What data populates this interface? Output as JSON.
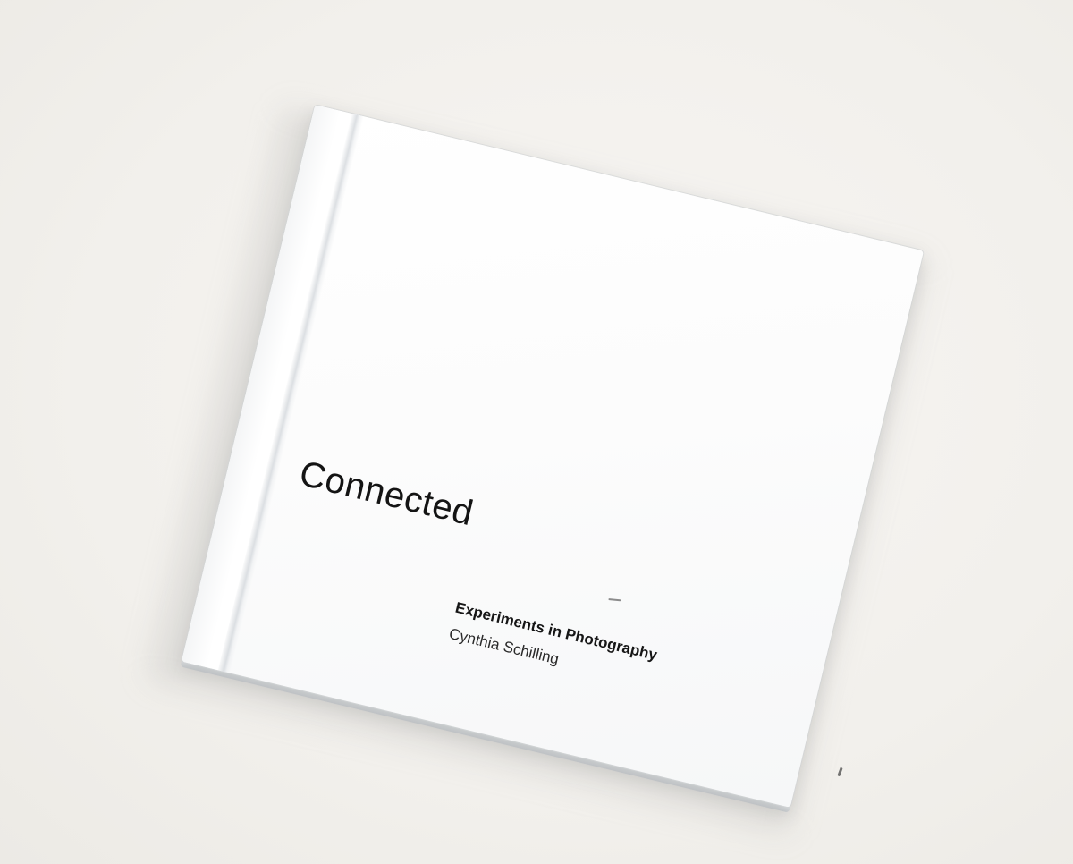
{
  "book": {
    "title": "Connected",
    "subtitle": "Experiments in Photography",
    "author": "Cynthia Schilling"
  },
  "colors": {
    "background": "#f4f2ee",
    "cover": "#ffffff",
    "text": "#141414"
  }
}
